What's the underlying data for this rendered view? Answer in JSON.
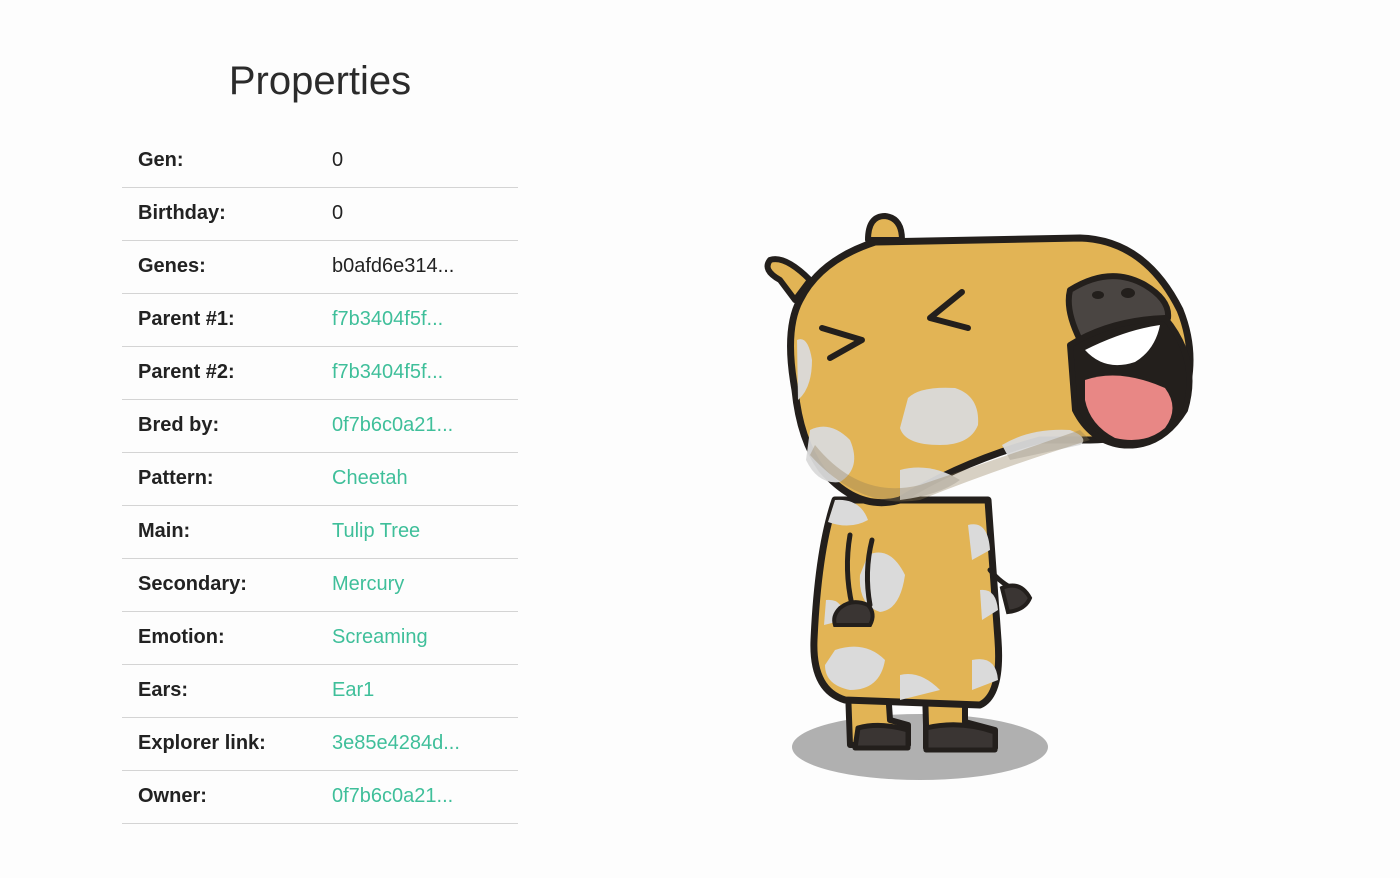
{
  "title": "Properties",
  "properties": [
    {
      "label": "Gen:",
      "value": "0",
      "link": false
    },
    {
      "label": "Birthday:",
      "value": "0",
      "link": false
    },
    {
      "label": "Genes:",
      "value": "b0afd6e314...",
      "link": false
    },
    {
      "label": "Parent #1:",
      "value": "f7b3404f5f...",
      "link": true
    },
    {
      "label": "Parent #2:",
      "value": "f7b3404f5f...",
      "link": true
    },
    {
      "label": "Bred by:",
      "value": "0f7b6c0a21...",
      "link": true
    },
    {
      "label": "Pattern:",
      "value": "Cheetah",
      "link": true
    },
    {
      "label": "Main:",
      "value": "Tulip Tree",
      "link": true
    },
    {
      "label": "Secondary:",
      "value": "Mercury",
      "link": true
    },
    {
      "label": "Emotion:",
      "value": "Screaming",
      "link": true
    },
    {
      "label": "Ears:",
      "value": "Ear1",
      "link": true
    },
    {
      "label": "Explorer link:",
      "value": "3e85e4284d...",
      "link": true
    },
    {
      "label": "Owner:",
      "value": "0f7b6c0a21...",
      "link": true
    }
  ],
  "colors": {
    "link": "#3fbf9a",
    "body_main": "#e2b455",
    "spots": "#dadada",
    "outline": "#231f1c",
    "tongue": "#e88785",
    "shadow": "#b0b0b0"
  },
  "image": {
    "icon": "capybara-screaming-image"
  }
}
